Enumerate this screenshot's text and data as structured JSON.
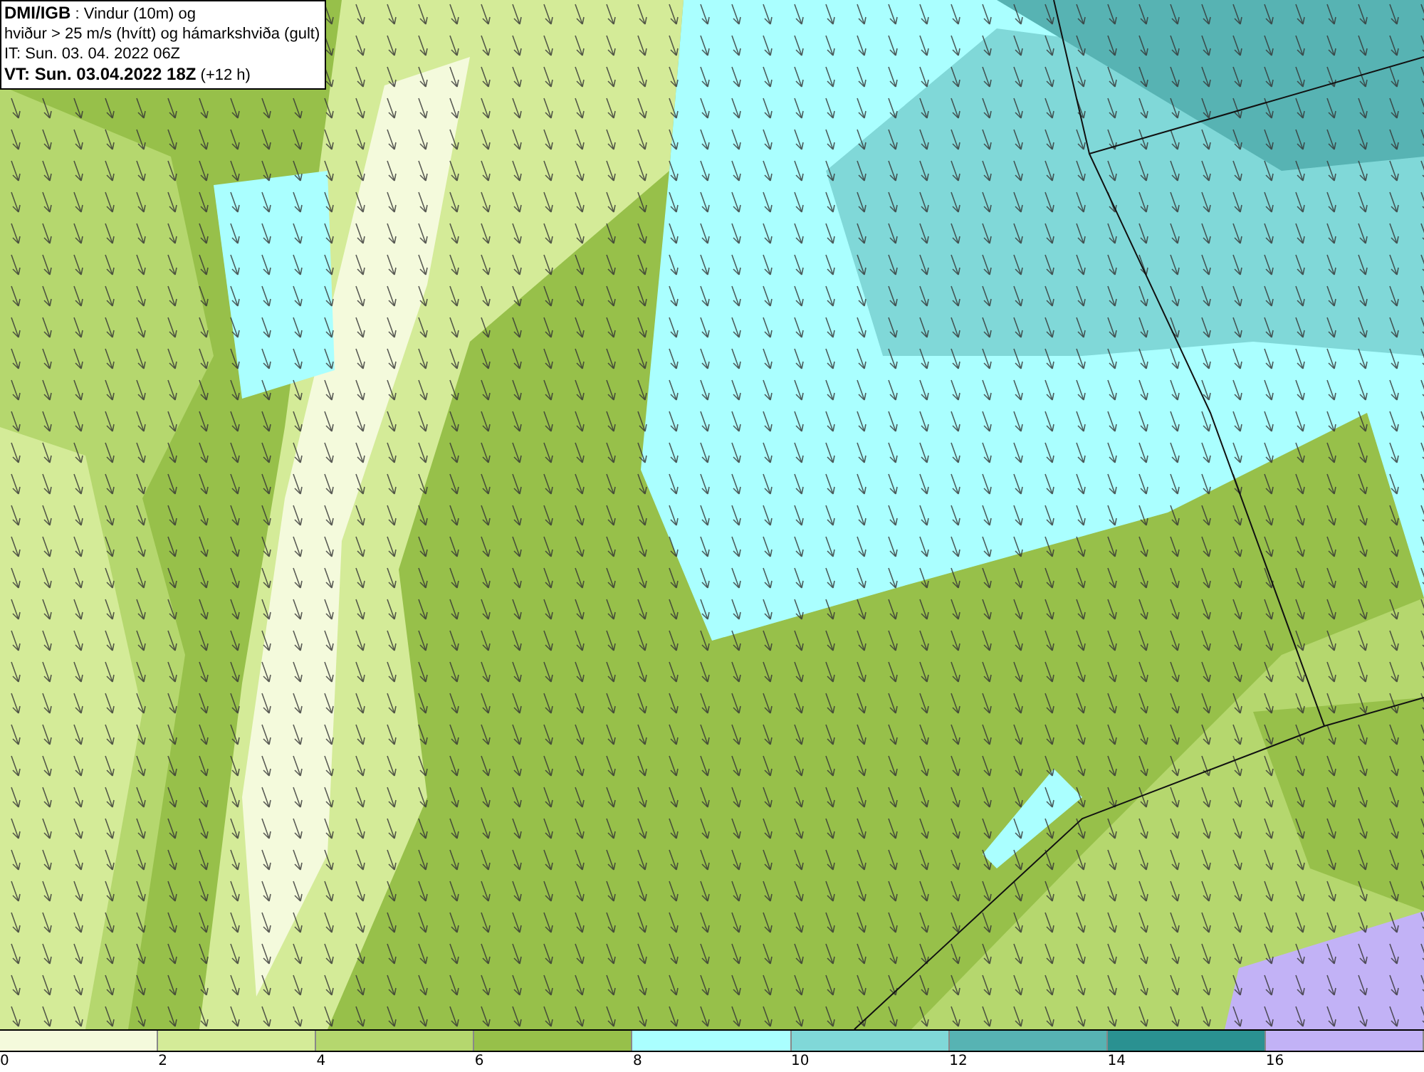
{
  "title_box": {
    "lines": [
      "**DMI/IGB** : Vindur (10m) og",
      "hviður > 25 m/s (hvítt) og hámarkshviða (gult)",
      "IT: Sun. 03. 04. 2022 06Z",
      "**VT: Sun. 03.04.2022 18Z** (+12 h)"
    ]
  },
  "legend": [
    {
      "label": "0",
      "color": "#f4fadc"
    },
    {
      "label": "2",
      "color": "#d4eb98"
    },
    {
      "label": "4",
      "color": "#b5d76e"
    },
    {
      "label": "6",
      "color": "#97c04a"
    },
    {
      "label": "8",
      "color": "#aaffff"
    },
    {
      "label": "10",
      "color": "#80d8d8"
    },
    {
      "label": "12",
      "color": "#57b3b3"
    },
    {
      "label": "14",
      "color": "#2a9191"
    },
    {
      "label": "16",
      "color": "#c2b2f6"
    }
  ]
}
